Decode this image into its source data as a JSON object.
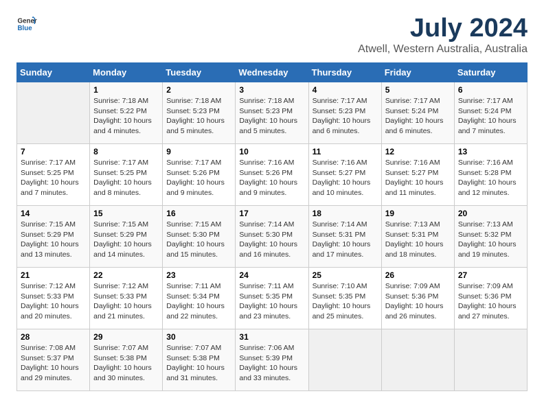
{
  "logo": {
    "general": "General",
    "blue": "Blue"
  },
  "title": "July 2024",
  "subtitle": "Atwell, Western Australia, Australia",
  "weekdays": [
    "Sunday",
    "Monday",
    "Tuesday",
    "Wednesday",
    "Thursday",
    "Friday",
    "Saturday"
  ],
  "weeks": [
    [
      {
        "day": "",
        "info": ""
      },
      {
        "day": "1",
        "info": "Sunrise: 7:18 AM\nSunset: 5:22 PM\nDaylight: 10 hours\nand 4 minutes."
      },
      {
        "day": "2",
        "info": "Sunrise: 7:18 AM\nSunset: 5:23 PM\nDaylight: 10 hours\nand 5 minutes."
      },
      {
        "day": "3",
        "info": "Sunrise: 7:18 AM\nSunset: 5:23 PM\nDaylight: 10 hours\nand 5 minutes."
      },
      {
        "day": "4",
        "info": "Sunrise: 7:17 AM\nSunset: 5:23 PM\nDaylight: 10 hours\nand 6 minutes."
      },
      {
        "day": "5",
        "info": "Sunrise: 7:17 AM\nSunset: 5:24 PM\nDaylight: 10 hours\nand 6 minutes."
      },
      {
        "day": "6",
        "info": "Sunrise: 7:17 AM\nSunset: 5:24 PM\nDaylight: 10 hours\nand 7 minutes."
      }
    ],
    [
      {
        "day": "7",
        "info": "Sunrise: 7:17 AM\nSunset: 5:25 PM\nDaylight: 10 hours\nand 7 minutes."
      },
      {
        "day": "8",
        "info": "Sunrise: 7:17 AM\nSunset: 5:25 PM\nDaylight: 10 hours\nand 8 minutes."
      },
      {
        "day": "9",
        "info": "Sunrise: 7:17 AM\nSunset: 5:26 PM\nDaylight: 10 hours\nand 9 minutes."
      },
      {
        "day": "10",
        "info": "Sunrise: 7:16 AM\nSunset: 5:26 PM\nDaylight: 10 hours\nand 9 minutes."
      },
      {
        "day": "11",
        "info": "Sunrise: 7:16 AM\nSunset: 5:27 PM\nDaylight: 10 hours\nand 10 minutes."
      },
      {
        "day": "12",
        "info": "Sunrise: 7:16 AM\nSunset: 5:27 PM\nDaylight: 10 hours\nand 11 minutes."
      },
      {
        "day": "13",
        "info": "Sunrise: 7:16 AM\nSunset: 5:28 PM\nDaylight: 10 hours\nand 12 minutes."
      }
    ],
    [
      {
        "day": "14",
        "info": "Sunrise: 7:15 AM\nSunset: 5:29 PM\nDaylight: 10 hours\nand 13 minutes."
      },
      {
        "day": "15",
        "info": "Sunrise: 7:15 AM\nSunset: 5:29 PM\nDaylight: 10 hours\nand 14 minutes."
      },
      {
        "day": "16",
        "info": "Sunrise: 7:15 AM\nSunset: 5:30 PM\nDaylight: 10 hours\nand 15 minutes."
      },
      {
        "day": "17",
        "info": "Sunrise: 7:14 AM\nSunset: 5:30 PM\nDaylight: 10 hours\nand 16 minutes."
      },
      {
        "day": "18",
        "info": "Sunrise: 7:14 AM\nSunset: 5:31 PM\nDaylight: 10 hours\nand 17 minutes."
      },
      {
        "day": "19",
        "info": "Sunrise: 7:13 AM\nSunset: 5:31 PM\nDaylight: 10 hours\nand 18 minutes."
      },
      {
        "day": "20",
        "info": "Sunrise: 7:13 AM\nSunset: 5:32 PM\nDaylight: 10 hours\nand 19 minutes."
      }
    ],
    [
      {
        "day": "21",
        "info": "Sunrise: 7:12 AM\nSunset: 5:33 PM\nDaylight: 10 hours\nand 20 minutes."
      },
      {
        "day": "22",
        "info": "Sunrise: 7:12 AM\nSunset: 5:33 PM\nDaylight: 10 hours\nand 21 minutes."
      },
      {
        "day": "23",
        "info": "Sunrise: 7:11 AM\nSunset: 5:34 PM\nDaylight: 10 hours\nand 22 minutes."
      },
      {
        "day": "24",
        "info": "Sunrise: 7:11 AM\nSunset: 5:35 PM\nDaylight: 10 hours\nand 23 minutes."
      },
      {
        "day": "25",
        "info": "Sunrise: 7:10 AM\nSunset: 5:35 PM\nDaylight: 10 hours\nand 25 minutes."
      },
      {
        "day": "26",
        "info": "Sunrise: 7:09 AM\nSunset: 5:36 PM\nDaylight: 10 hours\nand 26 minutes."
      },
      {
        "day": "27",
        "info": "Sunrise: 7:09 AM\nSunset: 5:36 PM\nDaylight: 10 hours\nand 27 minutes."
      }
    ],
    [
      {
        "day": "28",
        "info": "Sunrise: 7:08 AM\nSunset: 5:37 PM\nDaylight: 10 hours\nand 29 minutes."
      },
      {
        "day": "29",
        "info": "Sunrise: 7:07 AM\nSunset: 5:38 PM\nDaylight: 10 hours\nand 30 minutes."
      },
      {
        "day": "30",
        "info": "Sunrise: 7:07 AM\nSunset: 5:38 PM\nDaylight: 10 hours\nand 31 minutes."
      },
      {
        "day": "31",
        "info": "Sunrise: 7:06 AM\nSunset: 5:39 PM\nDaylight: 10 hours\nand 33 minutes."
      },
      {
        "day": "",
        "info": ""
      },
      {
        "day": "",
        "info": ""
      },
      {
        "day": "",
        "info": ""
      }
    ]
  ]
}
